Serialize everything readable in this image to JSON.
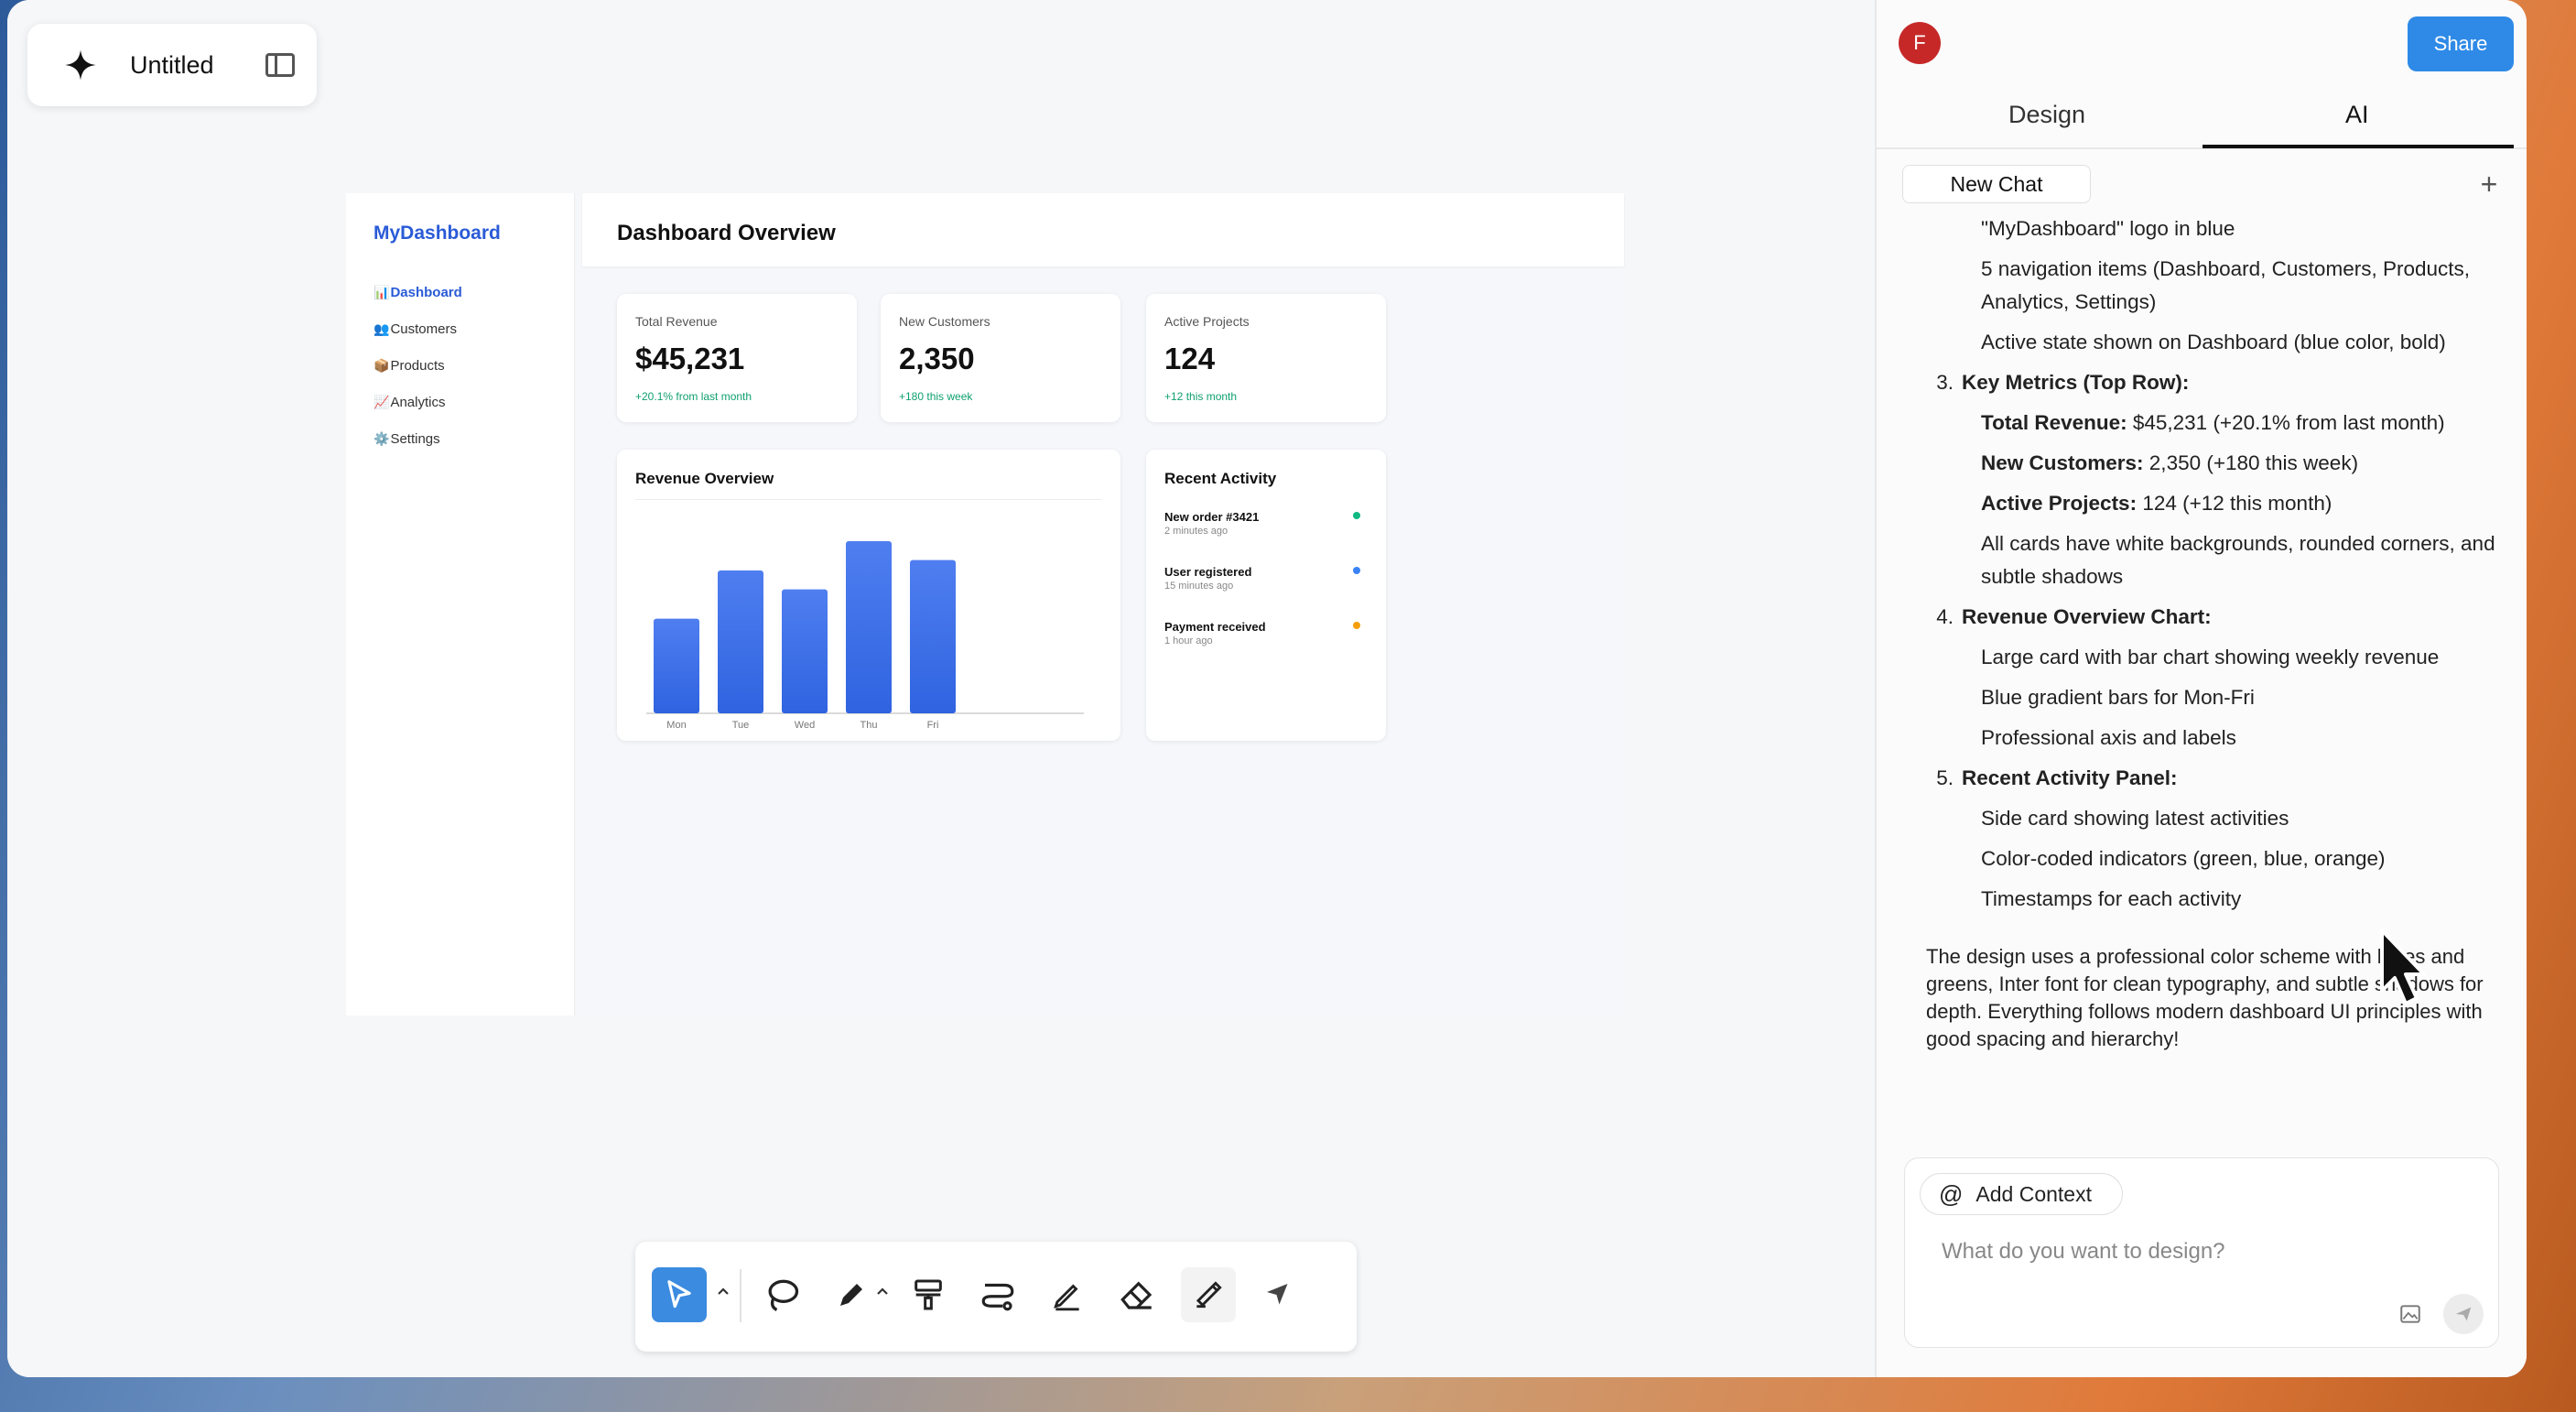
{
  "file": {
    "title": "Untitled"
  },
  "mockup": {
    "logo": "MyDashboard",
    "nav": [
      {
        "icon": "📊",
        "label": "Dashboard",
        "active": true
      },
      {
        "icon": "👥",
        "label": "Customers",
        "active": false
      },
      {
        "icon": "📦",
        "label": "Products",
        "active": false
      },
      {
        "icon": "📈",
        "label": "Analytics",
        "active": false
      },
      {
        "icon": "⚙️",
        "label": "Settings",
        "active": false
      }
    ],
    "page_title": "Dashboard Overview",
    "metrics": [
      {
        "label": "Total Revenue",
        "value": "$45,231",
        "change": "+20.1% from last month"
      },
      {
        "label": "New Customers",
        "value": "2,350",
        "change": "+180 this week"
      },
      {
        "label": "Active Projects",
        "value": "124",
        "change": "+12 this month"
      }
    ],
    "revenue_title": "Revenue Overview",
    "activity_title": "Recent Activity",
    "activity": [
      {
        "title": "New order #3421",
        "time": "2 minutes ago",
        "color": "#10b981"
      },
      {
        "title": "User registered",
        "time": "15 minutes ago",
        "color": "#3b82f6"
      },
      {
        "title": "Payment received",
        "time": "1 hour ago",
        "color": "#f59e0b"
      }
    ]
  },
  "chart_data": {
    "type": "bar",
    "title": "Revenue Overview",
    "categories": [
      "Mon",
      "Tue",
      "Wed",
      "Thu",
      "Fri"
    ],
    "values": [
      55,
      83,
      72,
      100,
      89
    ],
    "xlabel": "",
    "ylabel": "",
    "ylim": [
      0,
      100
    ],
    "grid": false,
    "colors": [
      "#4f7ef0",
      "#2f63e0"
    ]
  },
  "toolbar": {
    "tools": [
      "select-tool",
      "lasso-tool",
      "pen-tool",
      "paint-tool",
      "connector-tool",
      "pencil-tool",
      "eraser-tool",
      "highlighter-tool",
      "pointer-tool"
    ],
    "accent": "#3b8be0"
  },
  "panel": {
    "avatar": "F",
    "share": "Share",
    "tabs": [
      "Design",
      "AI"
    ],
    "active_tab": "AI",
    "new_chat": "New Chat",
    "message": {
      "bullets_a": [
        "\"MyDashboard\" logo in blue",
        "5 navigation items (Dashboard, Customers, Products, Analytics, Settings)",
        "Active state shown on Dashboard (blue color, bold)"
      ],
      "sec3_num": "3.",
      "sec3": "Key Metrics (Top Row):",
      "metric_lines": [
        {
          "b": "Total Revenue:",
          "t": " $45,231 (+20.1% from last month)"
        },
        {
          "b": "New Customers:",
          "t": " 2,350 (+180 this week)"
        },
        {
          "b": "Active Projects:",
          "t": " 124 (+12 this month)"
        }
      ],
      "metric_note": "All cards have white backgrounds, rounded corners, and subtle shadows",
      "sec4_num": "4.",
      "sec4": "Revenue Overview Chart:",
      "bullets_b": [
        "Large card with bar chart showing weekly revenue",
        "Blue gradient bars for Mon-Fri",
        "Professional axis and labels"
      ],
      "sec5_num": "5.",
      "sec5": "Recent Activity Panel:",
      "bullets_c": [
        "Side card showing latest activities",
        "Color-coded indicators (green, blue, orange)",
        "Timestamps for each activity"
      ],
      "summary": "The design uses a professional color scheme with blues and greens, Inter font for clean typography, and subtle shadows for depth. Everything follows modern dashboard UI principles with good spacing and hierarchy!"
    },
    "add_context": "Add Context",
    "prompt_placeholder": "What do you want to design?"
  }
}
